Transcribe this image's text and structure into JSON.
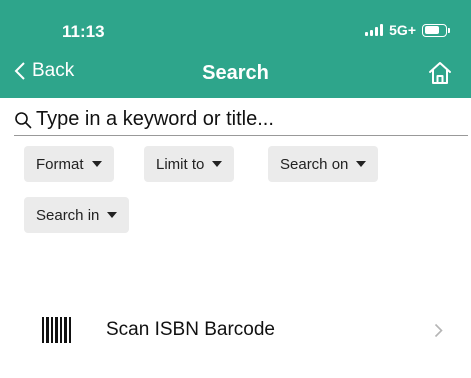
{
  "status_bar": {
    "time": "11:13",
    "network": "5G+"
  },
  "nav": {
    "back_label": "Back",
    "title": "Search"
  },
  "search": {
    "placeholder": "Type in a keyword or title..."
  },
  "filters": [
    {
      "label": "Format"
    },
    {
      "label": "Limit to"
    },
    {
      "label": "Search on"
    },
    {
      "label": "Search in"
    }
  ],
  "scan": {
    "label": "Scan ISBN Barcode"
  },
  "colors": {
    "accent": "#2ea58b",
    "chip_background": "#ebebeb"
  },
  "icons": {
    "back": "chevron-left-icon",
    "home": "home-icon",
    "search": "magnifier-icon",
    "dropdown": "caret-down-icon",
    "barcode": "barcode-icon",
    "disclosure": "chevron-right-icon"
  }
}
